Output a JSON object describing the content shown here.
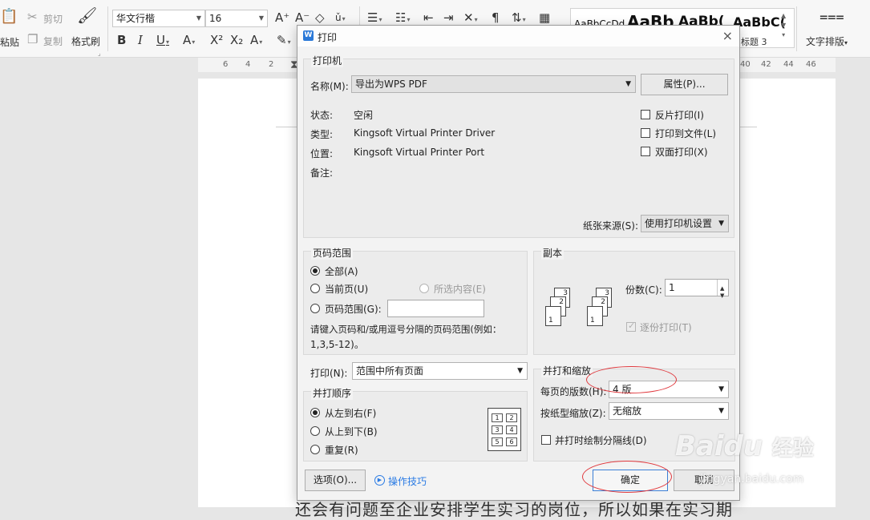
{
  "ribbon": {
    "paste": "粘贴",
    "cut": "剪切",
    "copy": "复制",
    "format_painter": "格式刷",
    "font_name": "华文行楷",
    "font_size": "16",
    "text_layout": "文字排版",
    "heading3": "标题 3",
    "style_samples": [
      "AaBbCcDd",
      "AaBb",
      "AaBb(",
      "AaBbC("
    ]
  },
  "ruler_ticks": [
    "6",
    "4",
    "2",
    "40",
    "42",
    "44",
    "46"
  ],
  "document": {
    "bottom_text": "还会有问题至企业安排学生实习的岗位，所以如果在实习期"
  },
  "dialog": {
    "title": "打印",
    "printer": {
      "group_title": "打印机",
      "name_label": "名称(M):",
      "name_value": "导出为WPS PDF",
      "properties_button": "属性(P)...",
      "status_label": "状态:",
      "status_value": "空闲",
      "type_label": "类型:",
      "type_value": "Kingsoft Virtual Printer Driver",
      "location_label": "位置:",
      "location_value": "Kingsoft Virtual Printer Port",
      "comment_label": "备注:",
      "reverse_print": "反片打印(I)",
      "print_to_file": "打印到文件(L)",
      "duplex": "双面打印(X)",
      "paper_source_label": "纸张来源(S):",
      "paper_source_value": "使用打印机设置"
    },
    "page_range": {
      "group_title": "页码范围",
      "all": "全部(A)",
      "current_page": "当前页(U)",
      "selection": "所选内容(E)",
      "pages": "页码范围(G):",
      "pages_value": "",
      "hint_line1": "请键入页码和/或用逗号分隔的页码范围(例如：",
      "hint_line2": "1,3,5-12)。"
    },
    "copies": {
      "group_title": "副本",
      "count_label": "份数(C):",
      "count_value": "1",
      "collate": "逐份打印(T)"
    },
    "print_what": {
      "label": "打印(N):",
      "value": "范围中所有页面"
    },
    "order": {
      "group_title": "并打顺序",
      "left_to_right": "从左到右(F)",
      "top_to_bottom": "从上到下(B)",
      "repeat": "重复(R)",
      "grid": [
        "1",
        "2",
        "3",
        "4",
        "5",
        "6"
      ]
    },
    "zoom": {
      "group_title": "并打和缩放",
      "pages_per_sheet_label": "每页的版数(H):",
      "pages_per_sheet_value": "4 版",
      "scale_label": "按纸型缩放(Z):",
      "scale_value": "无缩放",
      "draw_borders": "并打时绘制分隔线(D)"
    },
    "footer": {
      "options_button": "选项(O)...",
      "tips_link": "操作技巧",
      "ok_button": "确定",
      "cancel_button": "取消"
    }
  },
  "watermark": {
    "brand": "Baidu",
    "brand_cn": "经验",
    "url": "jingyan.baidu.com"
  },
  "colors": {
    "accent": "#2a7be4",
    "annotation": "#e0393e",
    "dialog_bg": "#f3f3f3"
  }
}
